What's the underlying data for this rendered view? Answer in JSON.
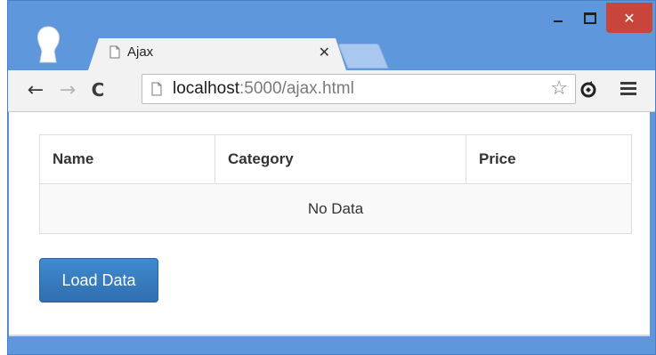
{
  "window": {
    "controls": {
      "minimize_label": "",
      "maximize_label": "",
      "close_label": "✕"
    }
  },
  "tab": {
    "title": "Ajax",
    "close_label": "✕"
  },
  "toolbar": {
    "back_label": "←",
    "forward_label": "→",
    "reload_label": "C",
    "url_host": "localhost",
    "url_path": ":5000/ajax.html",
    "star_label": "☆"
  },
  "table": {
    "headers": [
      "Name",
      "Category",
      "Price"
    ],
    "empty_message": "No Data"
  },
  "actions": {
    "load_button": "Load Data"
  },
  "colors": {
    "window_frame": "#5f97dc",
    "close_button": "#c7453b",
    "primary_button": "#337ab7"
  },
  "icons": {
    "profile": "profile-avatar-icon",
    "tab_favicon": "page-icon",
    "new_tab": "new-tab-icon",
    "back": "arrow-left-icon",
    "forward": "arrow-right-icon",
    "reload": "reload-icon",
    "url_page": "page-icon",
    "bookmark": "star-icon",
    "extension": "extension-icon",
    "menu": "hamburger-menu-icon"
  }
}
